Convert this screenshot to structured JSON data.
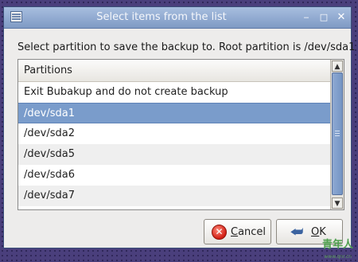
{
  "window": {
    "title": "Select items from the list",
    "minimize_glyph": "‒",
    "maximize_glyph": "□",
    "close_glyph": "✕"
  },
  "prompt": "Select partition to save the backup to. Root partition is /dev/sda1",
  "list": {
    "column_header": "Partitions",
    "items": [
      {
        "label": "Exit Bubakup and do not create backup",
        "selected": false
      },
      {
        "label": "/dev/sda1",
        "selected": true
      },
      {
        "label": "/dev/sda2",
        "selected": false
      },
      {
        "label": "/dev/sda5",
        "selected": false
      },
      {
        "label": "/dev/sda6",
        "selected": false
      },
      {
        "label": "/dev/sda7",
        "selected": false
      }
    ]
  },
  "buttons": {
    "cancel_mnemonic": "C",
    "cancel_rest": "ancel",
    "ok_mnemonic": "O",
    "ok_rest": "K",
    "cancel_icon": "cancel-icon",
    "ok_icon": "ok-icon"
  },
  "watermark": {
    "text": "青年人",
    "sub": "www.qnr.cn"
  },
  "colors": {
    "selection": "#7a9ccb",
    "titlebar": "#8fa8d0",
    "desktop": "#4a3f7c"
  }
}
